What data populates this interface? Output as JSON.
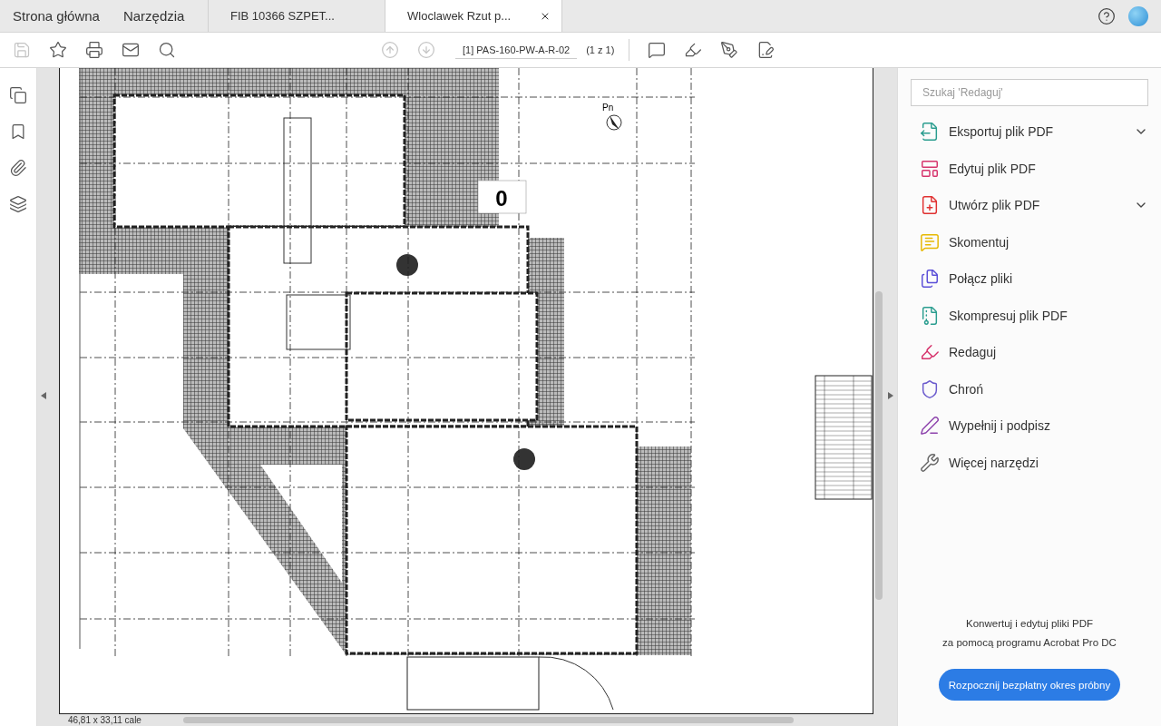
{
  "nav": [
    "Strona główna",
    "Narzędzia"
  ],
  "doc_tabs": [
    {
      "label": "FIB 10366 SZPET...",
      "selected": false
    },
    {
      "label": "Wloclawek Rzut p...",
      "selected": true
    }
  ],
  "toolbar": {
    "left": [
      {
        "kind": "save",
        "disabled": true
      },
      {
        "kind": "star",
        "disabled": false
      },
      {
        "kind": "print",
        "disabled": false
      },
      {
        "kind": "mail",
        "disabled": false
      },
      {
        "kind": "search",
        "disabled": false
      }
    ],
    "nav_buttons": [
      {
        "kind": "up",
        "disabled": true
      },
      {
        "kind": "down",
        "disabled": true
      }
    ],
    "page_field": "[1] PAS-160-PW-A-R-02",
    "page_count": "(1 z 1)",
    "right": [
      {
        "kind": "comment"
      },
      {
        "kind": "highlight"
      },
      {
        "kind": "sign"
      },
      {
        "kind": "fill"
      }
    ]
  },
  "left_rail": [
    {
      "kind": "pages"
    },
    {
      "kind": "bookmark"
    },
    {
      "kind": "attachment"
    },
    {
      "kind": "layers"
    }
  ],
  "document": {
    "level_label": "0",
    "north_label": "Pn",
    "size": "46,81 x 33,11 cale"
  },
  "panel": {
    "search": {
      "placeholder": "Szukaj 'Redaguj'"
    },
    "tools": [
      {
        "kind": "export",
        "label": "Eksportuj plik PDF",
        "expandable": true
      },
      {
        "kind": "edit",
        "label": "Edytuj plik PDF",
        "expandable": false
      },
      {
        "kind": "create",
        "label": "Utwórz plik PDF",
        "expandable": true
      },
      {
        "kind": "comment",
        "label": "Skomentuj",
        "expandable": false
      },
      {
        "kind": "combine",
        "label": "Połącz pliki",
        "expandable": false
      },
      {
        "kind": "compress",
        "label": "Skompresuj plik PDF",
        "expandable": false
      },
      {
        "kind": "redact",
        "label": "Redaguj",
        "expandable": false
      },
      {
        "kind": "protect",
        "label": "Chroń",
        "expandable": false
      },
      {
        "kind": "sign",
        "label": "Wypełnij i podpisz",
        "expandable": false
      },
      {
        "kind": "more",
        "label": "Więcej narzędzi",
        "expandable": false
      }
    ],
    "promo": [
      "Konwertuj i edytuj pliki PDF",
      "za pomocą programu Acrobat Pro DC"
    ],
    "cta": "Rozpocznij bezpłatny okres próbny"
  }
}
